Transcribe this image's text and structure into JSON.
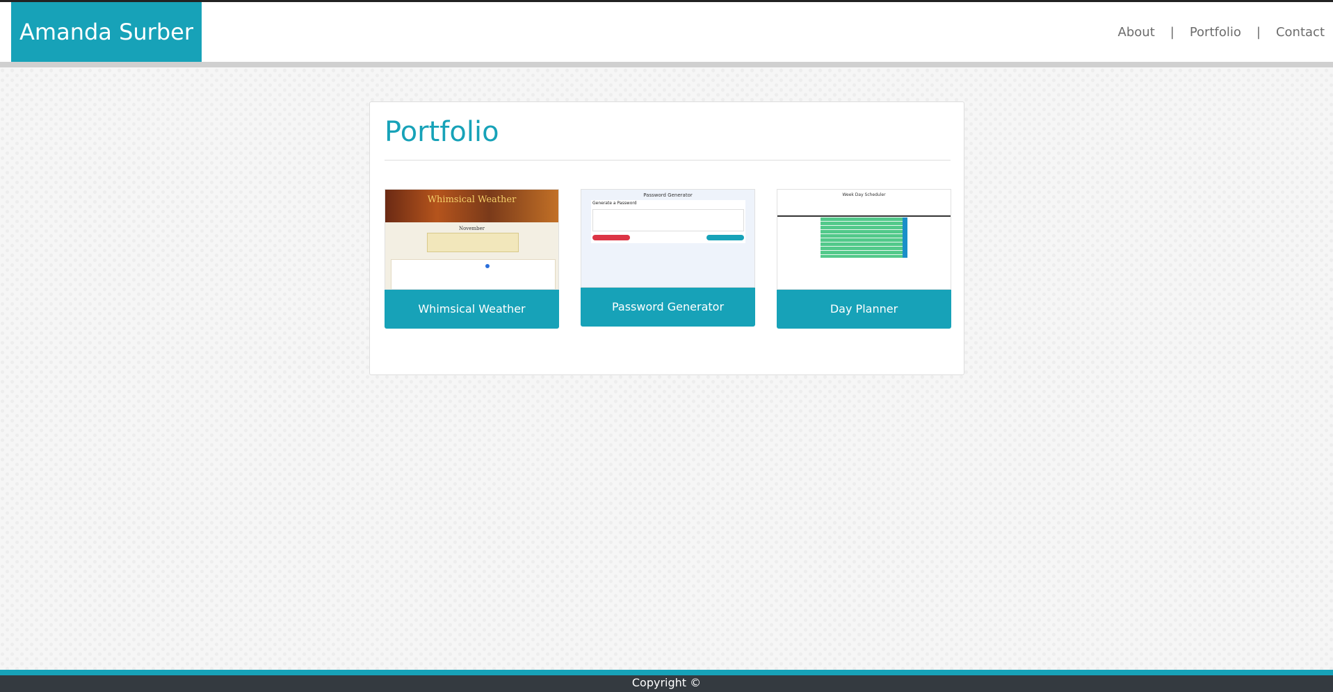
{
  "header": {
    "brand": "Amanda Surber",
    "nav": [
      {
        "label": "About"
      },
      {
        "label": "Portfolio"
      },
      {
        "label": "Contact"
      }
    ],
    "separator": "|"
  },
  "portfolio": {
    "title": "Portfolio",
    "projects": [
      {
        "label": "Whimsical Weather",
        "thumbnail": {
          "banner_title": "Whimsical Weather",
          "month": "November"
        }
      },
      {
        "label": "Password Generator",
        "thumbnail": {
          "title": "Password Generator",
          "panel_title": "Generate a Password"
        }
      },
      {
        "label": "Day Planner",
        "thumbnail": {
          "title": "Week Day Scheduler"
        }
      }
    ]
  },
  "footer": {
    "text": "Copyright ©"
  },
  "colors": {
    "accent": "#17a2b8",
    "footer_bg": "#343a40",
    "danger": "#dc3545"
  }
}
